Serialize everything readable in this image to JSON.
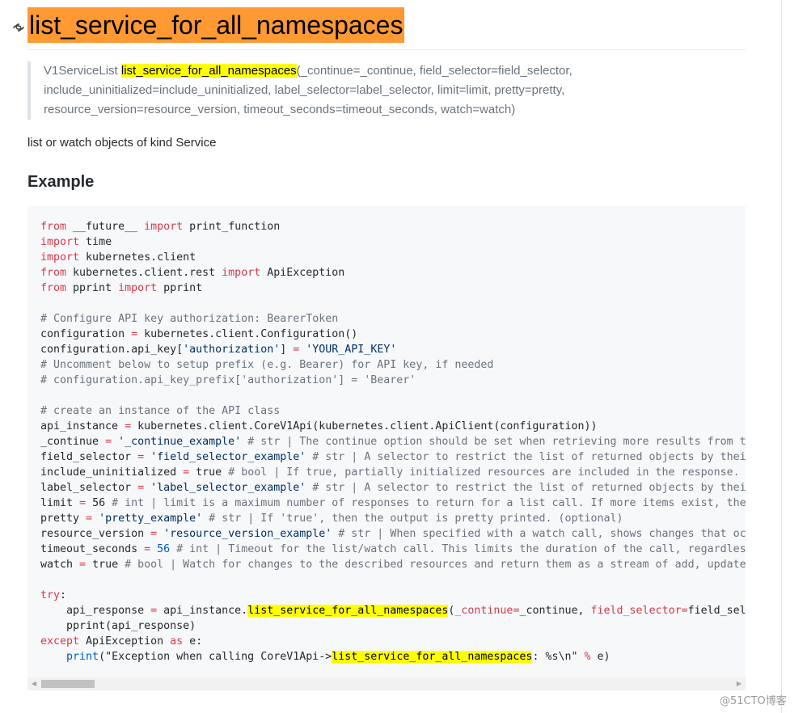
{
  "heading": {
    "title": "list_service_for_all_namespaces",
    "highlight_color": "#ff9933",
    "icon": "link-icon"
  },
  "signature": {
    "return_type": "V1ServiceList",
    "method": "list_service_for_all_namespaces",
    "line1_rest": "(_continue=_continue, field_selector=field_selector,",
    "line2": "include_uninitialized=include_uninitialized, label_selector=label_selector, limit=limit, pretty=pretty,",
    "line3": "resource_version=resource_version, timeout_seconds=timeout_seconds, watch=watch)"
  },
  "description": "list or watch objects of kind Service",
  "example_heading": "Example",
  "code": {
    "l1": {
      "a": "from",
      "b": " __future__ ",
      "c": "import",
      "d": " print_function"
    },
    "l2": {
      "a": "import",
      "b": " time"
    },
    "l3": {
      "a": "import",
      "b": " kubernetes.client"
    },
    "l4": {
      "a": "from",
      "b": " kubernetes.client.rest ",
      "c": "import",
      "d": " ApiException"
    },
    "l5": {
      "a": "from",
      "b": " pprint ",
      "c": "import",
      "d": " pprint"
    },
    "l7": "# Configure API key authorization: BearerToken",
    "l8": {
      "a": "configuration ",
      "b": "=",
      "c": " kubernetes.client.Configuration()"
    },
    "l9": {
      "a": "configuration.api_key[",
      "b": "'authorization'",
      "c": "] ",
      "d": "=",
      "e": " ",
      "f": "'YOUR_API_KEY'"
    },
    "l10": "# Uncomment below to setup prefix (e.g. Bearer) for API key, if needed",
    "l11": "# configuration.api_key_prefix['authorization'] = 'Bearer'",
    "l13": "# create an instance of the API class",
    "l14": {
      "a": "api_instance ",
      "b": "=",
      "c": " kubernetes.client.CoreV1Api(kubernetes.client.ApiClient(configuration))"
    },
    "l15": {
      "a": "_continue ",
      "b": "=",
      "c": " ",
      "d": "'_continue_example'",
      "e": " # str | The continue option should be set when retrieving more results from t"
    },
    "l16": {
      "a": "field_selector ",
      "b": "=",
      "c": " ",
      "d": "'field_selector_example'",
      "e": " # str | A selector to restrict the list of returned objects by thei"
    },
    "l17": {
      "a": "include_uninitialized ",
      "b": "=",
      "c": " true ",
      "e": "# bool | If true, partially initialized resources are included in the response."
    },
    "l18": {
      "a": "label_selector ",
      "b": "=",
      "c": " ",
      "d": "'label_selector_example'",
      "e": " # str | A selector to restrict the list of returned objects by thei"
    },
    "l19": {
      "a": "limit ",
      "b": "=",
      "c": " 56 ",
      "e": "# int | limit is a maximum number of responses to return for a list call. If more items exist, the"
    },
    "l20": {
      "a": "pretty ",
      "b": "=",
      "c": " ",
      "d": "'pretty_example'",
      "e": " # str | If 'true', then the output is pretty printed. (optional)"
    },
    "l21": {
      "a": "resource_version ",
      "b": "=",
      "c": " ",
      "d": "'resource_version_example'",
      "e": " # str | When specified with a watch call, shows changes that oc"
    },
    "l22": {
      "a": "timeout_seconds ",
      "b": "=",
      "c": " ",
      "n": "56",
      "e": " # int | Timeout for the list/watch call. This limits the duration of the call, regardles"
    },
    "l23": {
      "a": "watch ",
      "b": "=",
      "c": " true ",
      "e": "# bool | Watch for changes to the described resources and return them as a stream of add, update"
    },
    "l25": {
      "a": "try",
      "b": ":"
    },
    "l26": {
      "a": "    api_response ",
      "b": "=",
      "c": " api_instance.",
      "d": "list_service_for_all_namespaces",
      "e": "(",
      "f": "_continue",
      "g": "=",
      "h": "_continue, ",
      "i": "field_selector",
      "j": "=",
      "k": "field_sel"
    },
    "l27": "    pprint(api_response)",
    "l28": {
      "a": "except",
      "b": " ApiException ",
      "c": "as",
      "d": " e:"
    },
    "l29": {
      "a": "    ",
      "b": "print",
      "c": "(\"Exception when calling CoreV1Api->",
      "d": "list_service_for_all_namespaces",
      "e": ": %s\\n\" ",
      "f": "%",
      "g": " e)"
    }
  },
  "watermark": "@51CTO博客"
}
